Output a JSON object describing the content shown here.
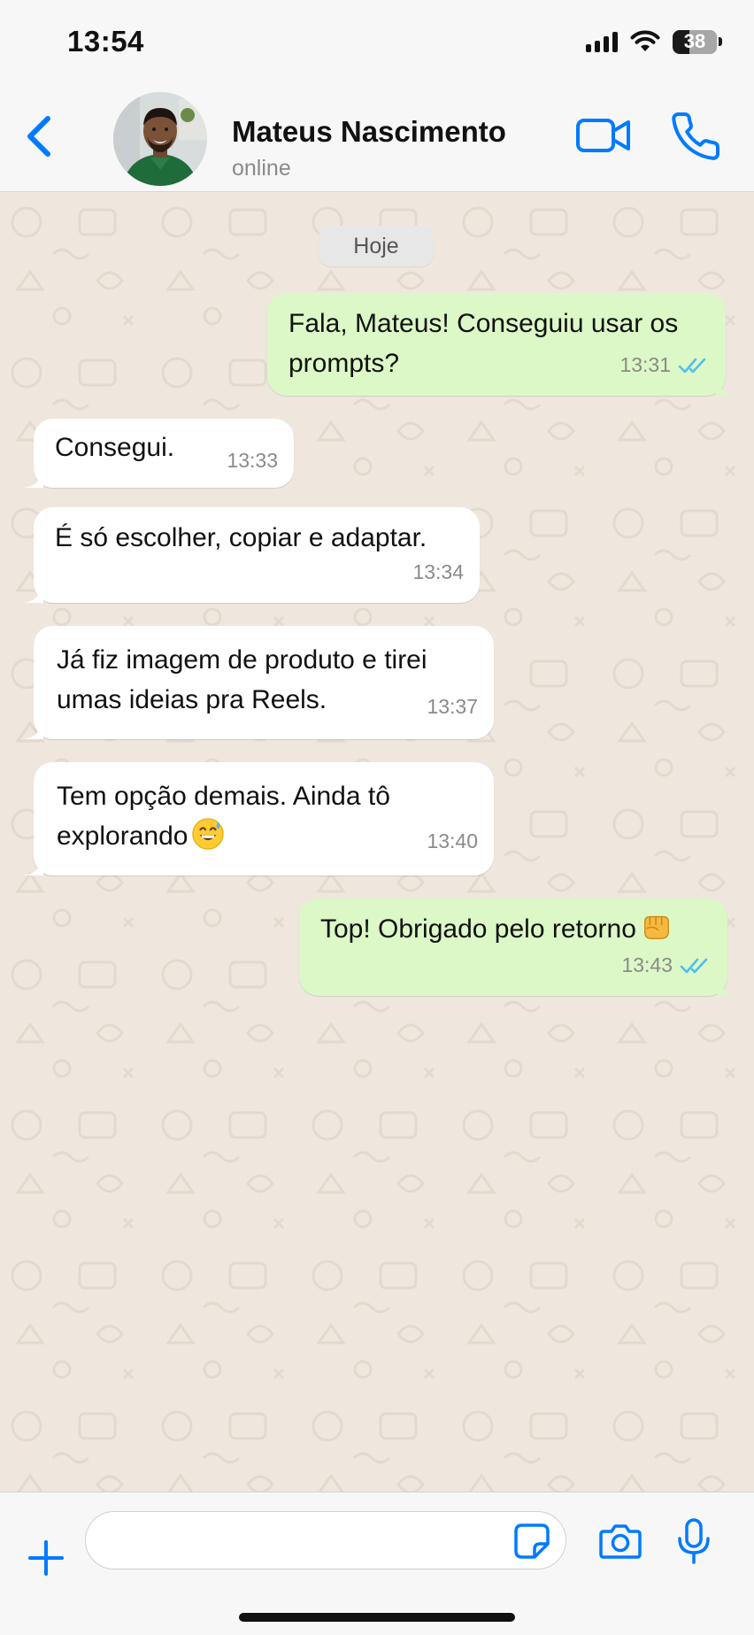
{
  "status_bar": {
    "time": "13:54",
    "battery_level": "38",
    "battery_fraction": 0.38
  },
  "header": {
    "contact_name": "Mateus Nascimento",
    "contact_status": "online",
    "icons": [
      "chevron-left-icon",
      "video-camera-icon",
      "phone-icon"
    ]
  },
  "chat": {
    "date_label": "Hoje",
    "messages": [
      {
        "direction": "out",
        "lines": [
          "Fala, Mateus! Conseguiu usar os",
          "prompts?"
        ],
        "time": "13:31",
        "read": true
      },
      {
        "direction": "in",
        "lines": [
          "Consegui."
        ],
        "time": "13:33"
      },
      {
        "direction": "in",
        "lines": [
          "É só escolher, copiar e adaptar."
        ],
        "time": "13:34"
      },
      {
        "direction": "in",
        "lines": [
          "Já fiz imagem de produto e tirei",
          "umas ideias pra Reels."
        ],
        "time": "13:37"
      },
      {
        "direction": "in",
        "lines": [
          "Tem opção demais. Ainda tô",
          "explorando"
        ],
        "emoji": "grinning-sweat-emoji",
        "time": "13:40"
      },
      {
        "direction": "out",
        "lines": [
          "Top! Obrigado pelo retorno"
        ],
        "emoji": "oncoming-fist-emoji",
        "time": "13:43",
        "read": true
      }
    ]
  },
  "composer": {
    "input_value": "",
    "icons": [
      "plus-icon",
      "sticker-icon",
      "camera-icon",
      "microphone-icon"
    ]
  },
  "colors": {
    "accent": "#007aff",
    "outgoing_bubble": "#dbf8c6",
    "incoming_bubble": "#ffffff",
    "chat_background": "#efe7de",
    "read_receipt": "#53bdeb"
  }
}
